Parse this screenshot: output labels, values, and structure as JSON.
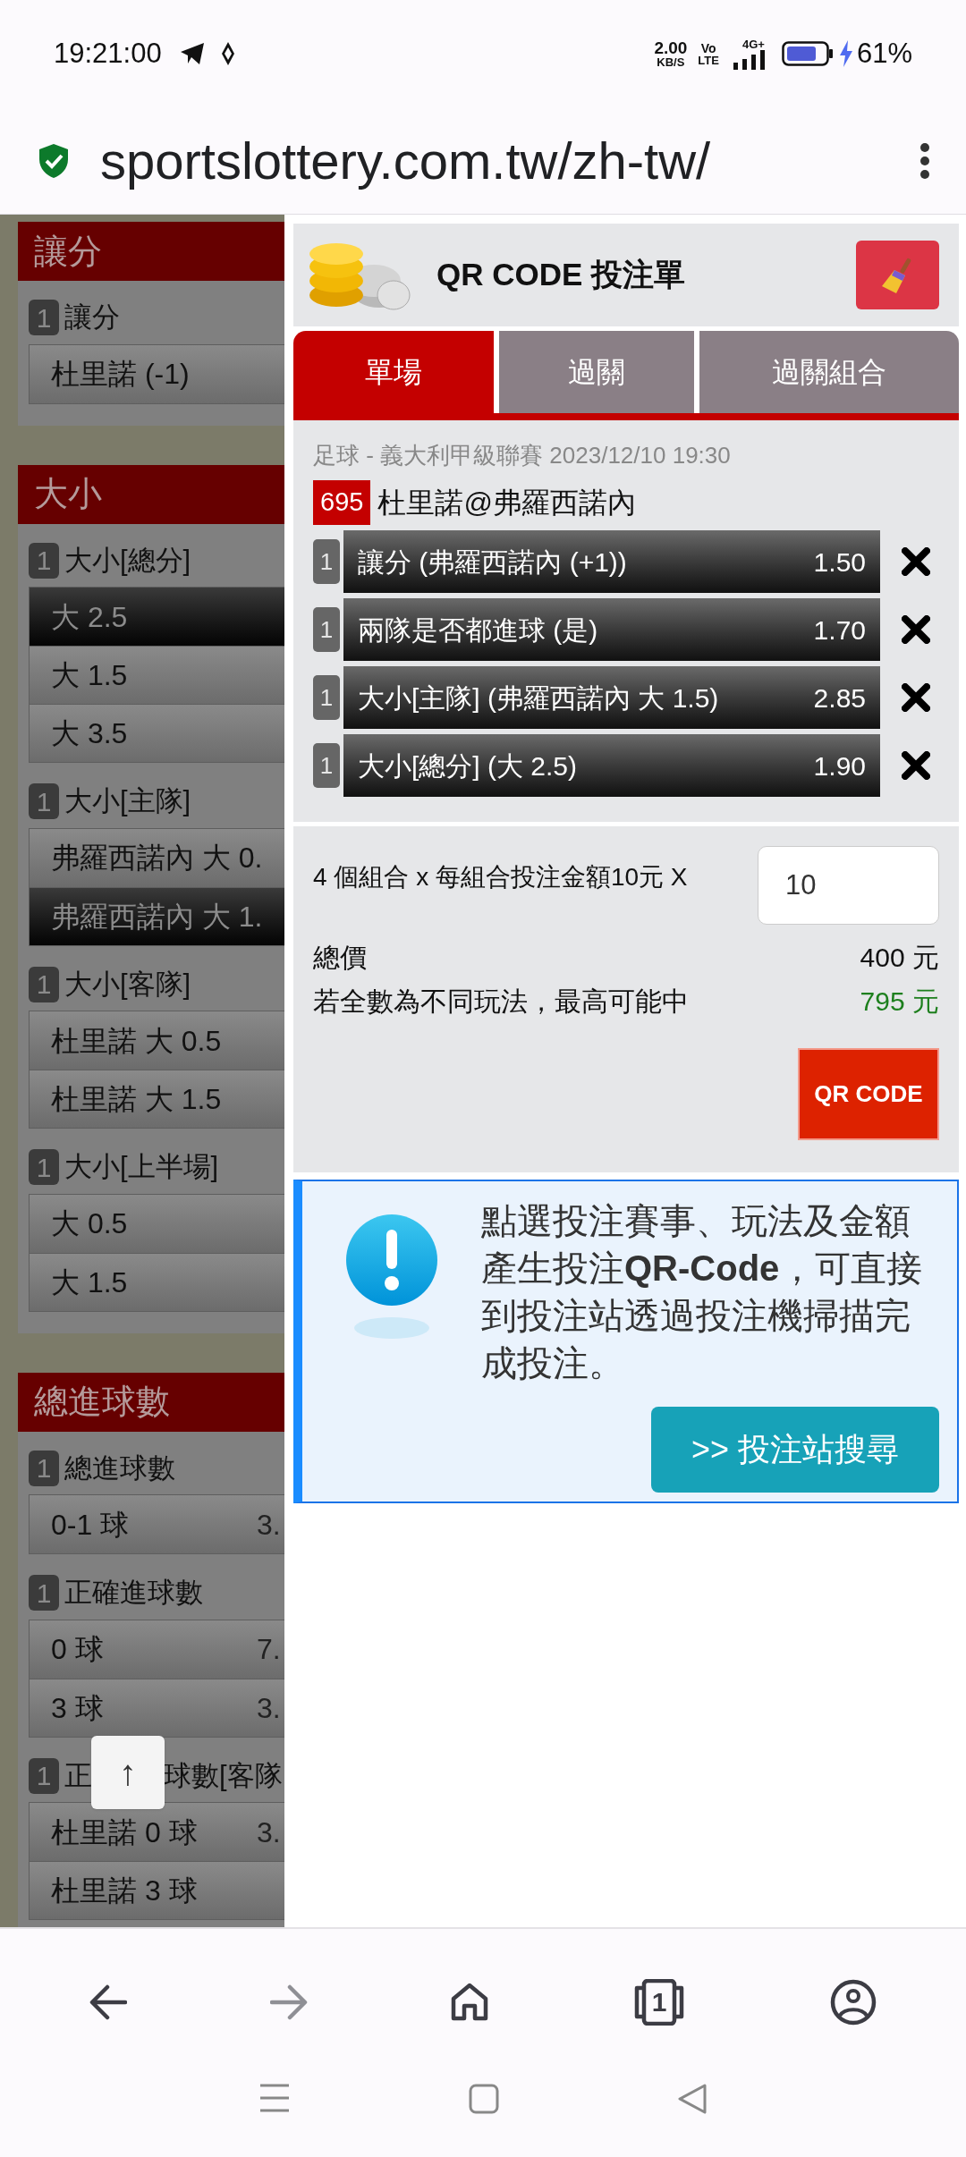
{
  "status_bar": {
    "time": "19:21:00",
    "net_speed": "2.00",
    "net_unit": "KB/S",
    "volte_top": "Vo",
    "volte_bottom": "LTE",
    "network": "4G+",
    "battery": "61%"
  },
  "address_bar": {
    "url": "sportslottery.com.tw/zh-tw/"
  },
  "background_page": {
    "sections": [
      {
        "title": "讓分",
        "groups": [
          {
            "count": "1",
            "title": "讓分",
            "options": [
              {
                "label": "杜里諾 (-1)",
                "selected": false
              }
            ]
          }
        ]
      },
      {
        "title": "大小",
        "groups": [
          {
            "count": "1",
            "title": "大小[總分]",
            "options": [
              {
                "label": "大 2.5",
                "selected": true
              },
              {
                "label": "大 1.5",
                "selected": false
              },
              {
                "label": "大 3.5",
                "selected": false
              }
            ]
          },
          {
            "count": "1",
            "title": "大小[主隊]",
            "options": [
              {
                "label": "弗羅西諾內 大 0.",
                "selected": false
              },
              {
                "label": "弗羅西諾內 大 1.",
                "selected": true
              }
            ]
          },
          {
            "count": "1",
            "title": "大小[客隊]",
            "options": [
              {
                "label": "杜里諾 大 0.5",
                "selected": false
              },
              {
                "label": "杜里諾 大 1.5",
                "selected": false
              }
            ]
          },
          {
            "count": "1",
            "title": "大小[上半場]",
            "options": [
              {
                "label": "大 0.5",
                "selected": false
              },
              {
                "label": "大 1.5",
                "selected": false
              }
            ]
          }
        ]
      },
      {
        "title": "總進球數",
        "groups": [
          {
            "count": "1",
            "title": "總進球數",
            "options": [
              {
                "label": "0-1 球",
                "odds": "3.",
                "selected": false
              }
            ]
          },
          {
            "count": "1",
            "title": "正確進球數",
            "options": [
              {
                "label": "0 球",
                "odds": "7.",
                "selected": false
              },
              {
                "label": "3 球",
                "odds": "3.",
                "selected": false
              }
            ]
          },
          {
            "count": "1",
            "title": "正",
            "title_after_button": "球數[客隊",
            "options": [
              {
                "label": "杜里諾 0 球",
                "odds": "3.",
                "selected": false
              },
              {
                "label": "杜里諾 3 球",
                "selected": false
              }
            ]
          }
        ]
      }
    ]
  },
  "scroll_top_button": {
    "label": "↑"
  },
  "bet_slip": {
    "title": "QR CODE 投注單",
    "tabs": [
      {
        "label": "單場",
        "selected": true
      },
      {
        "label": "過關",
        "selected": false
      },
      {
        "label": "過關組合",
        "selected": false
      }
    ],
    "match": {
      "info": "足球 - 義大利甲級聯賽 2023/12/10 19:30",
      "number": "695",
      "teams": "杜里諾@弗羅西諾內"
    },
    "bets": [
      {
        "count": "1",
        "label": "讓分 (弗羅西諾內 (+1))",
        "odds": "1.50"
      },
      {
        "count": "1",
        "label": "兩隊是否都進球 (是)",
        "odds": "1.70"
      },
      {
        "count": "1",
        "label": "大小[主隊] (弗羅西諾內 大 1.5)",
        "odds": "2.85"
      },
      {
        "count": "1",
        "label": "大小[總分] (大 2.5)",
        "odds": "1.90"
      }
    ],
    "stake": {
      "label": "4 個組合 x 每組合投注金額10元 X",
      "value": "10"
    },
    "total": {
      "label": "總價",
      "value": "400 元"
    },
    "max_win": {
      "label": "若全數為不同玩法，最高可能中",
      "value": "795 元"
    },
    "submit_button": "QR CODE"
  },
  "info_box": {
    "text": "點選投注賽事、玩法及金額產生投注**QR-Code**，可直接到投注站透過投注機掃描完成投注。",
    "button": ">> 投注站搜尋"
  },
  "browser_nav": {
    "tab_count": "1"
  }
}
